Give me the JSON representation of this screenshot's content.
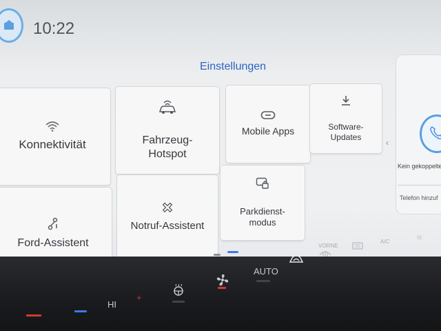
{
  "status": {
    "time": "10:22"
  },
  "page": {
    "title": "Einstellungen"
  },
  "tiles": [
    {
      "label": "Konnektivität",
      "icon": "wifi-icon"
    },
    {
      "label": "Fahrzeug-\nHotspot",
      "icon": "car-hotspot-icon"
    },
    {
      "label": "Mobile Apps",
      "icon": "link-icon"
    },
    {
      "label": "Software-\nUpdates",
      "icon": "download-icon"
    },
    {
      "label": "Ford-Assistent",
      "icon": "assistant-icon"
    },
    {
      "label": "Notruf-Assistent",
      "icon": "emergency-icon"
    },
    {
      "label": "Parkdienst-\nmodus",
      "icon": "valet-lock-icon"
    }
  ],
  "right_panel": {
    "line1": "Kein gekoppelte",
    "line2": "Telefon hinzuf"
  },
  "climate": {
    "hi_label": "HI",
    "auto_label": "AUTO",
    "vorne_label": "VORNE",
    "ac_label": "A/C"
  },
  "colors": {
    "accent": "#2d63c4",
    "indicator_red": "#d23a32",
    "indicator_blue": "#3d7be0"
  }
}
